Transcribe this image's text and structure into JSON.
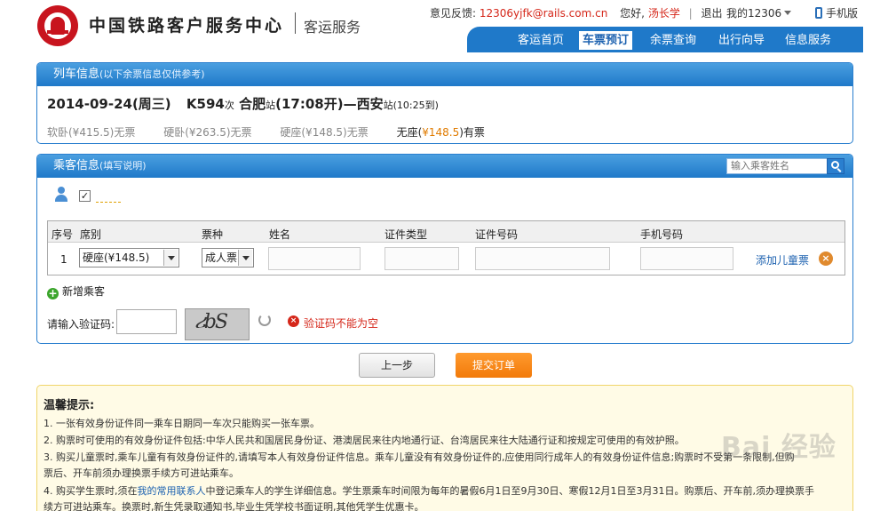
{
  "header": {
    "brand": "中国铁路客户服务中心",
    "brand_sub": "客运服务",
    "feedback_label": "意见反馈:",
    "feedback_email": "12306yjfk@rails.com.cn",
    "greeting": "您好,",
    "username": "汤长学",
    "logout": "退出",
    "my12306": "我的12306",
    "mobile": "手机版"
  },
  "nav": {
    "items": [
      "客运首页",
      "车票预订",
      "余票查询",
      "出行向导",
      "信息服务"
    ]
  },
  "train_panel": {
    "title": "列车信息",
    "title_note": "(以下余票信息仅供参考)",
    "date": "2014-09-24(周三)",
    "train_no": "K594",
    "train_suffix": "次",
    "from": "合肥",
    "from_suffix": "站",
    "depart": "(17:08开)",
    "dash": "—",
    "to": "西安",
    "to_suffix": "站",
    "arrive": "(10:25到)",
    "seats": [
      {
        "text": "软卧(¥415.5)无票"
      },
      {
        "text": "硬卧(¥263.5)无票"
      },
      {
        "text": "硬座(¥148.5)无票"
      }
    ],
    "avail_seat": {
      "prefix": "无座(",
      "price": "¥148.5",
      "suffix": ")有票"
    }
  },
  "passenger_panel": {
    "title": "乘客信息",
    "title_note": "(填写说明)",
    "search_placeholder": "输入乘客姓名",
    "columns": [
      "序号",
      "席别",
      "票种",
      "姓名",
      "证件类型",
      "证件号码",
      "手机号码"
    ],
    "row": {
      "index": "1",
      "seat": "硬座(¥148.5)",
      "ticket_type": "成人票",
      "add_child": "添加儿童票"
    },
    "add_passenger": "新增乘客",
    "captcha_label": "请输入验证码:",
    "captcha_text": "ሪbS",
    "error": "验证码不能为空"
  },
  "buttons": {
    "prev": "上一步",
    "submit": "提交订单"
  },
  "tips": {
    "title": "温馨提示:",
    "lines": [
      "1. 一张有效身份证件同一乘车日期同一车次只能购买一张车票。",
      "2. 购票时可使用的有效身份证件包括:中华人民共和国居民身份证、港澳居民来往内地通行证、台湾居民来往大陆通行证和按规定可使用的有效护照。",
      "3. 购买儿童票时,乘车儿童有有效身份证件的,请填写本人有效身份证件信息。乘车儿童没有有效身份证件的,应使用同行成年人的有效身份证件信息;购票时不受第一条限制,但购",
      "票后、开车前须办理换票手续方可进站乘车。",
      "4. 购买学生票时,须在",
      "续方可进站乘车。换票时,新生凭录取通知书,毕业生凭学校书面证明,其他凭学生优惠卡。"
    ],
    "link": "我的常用联系人",
    "line4_rest": "中登记乘车人的学生详细信息。学生票乘车时间限为每年的暑假6月1日至9月30日、寒假12月1日至3月31日。购票后、开车前,须办理换票手"
  },
  "watermark": "Bai 经验"
}
